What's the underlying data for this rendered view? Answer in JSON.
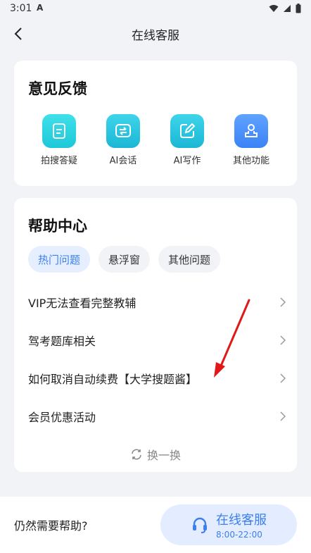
{
  "status_bar": {
    "time": "3:01",
    "notif_icon": "A",
    "icons": [
      "wifi-icon",
      "signal-icon",
      "battery-icon"
    ]
  },
  "nav": {
    "title": "在线客服",
    "back_icon": "chevron-left-icon"
  },
  "feedback": {
    "title": "意见反馈",
    "items": [
      {
        "label": "拍搜答疑",
        "icon": "document-icon",
        "color": "#22cfdf"
      },
      {
        "label": "AI会话",
        "icon": "chat-swap-icon",
        "color": "#22c0db"
      },
      {
        "label": "AI写作",
        "icon": "edit-pencil-icon",
        "color": "#22c0db"
      },
      {
        "label": "其他功能",
        "icon": "person-stamp-icon",
        "color": "#4b90fa"
      }
    ]
  },
  "help_center": {
    "title": "帮助中心",
    "tabs": [
      {
        "label": "热门问题",
        "active": true
      },
      {
        "label": "悬浮窗",
        "active": false
      },
      {
        "label": "其他问题",
        "active": false
      }
    ],
    "questions": [
      "VIP无法查看完整教辅",
      "驾考题库相关",
      "如何取消自动续费【大学搜题酱】",
      "会员优惠活动"
    ],
    "refresh_label": "换一换"
  },
  "bottom": {
    "help_text": "仍然需要帮助?",
    "cs_button": {
      "label": "在线客服",
      "hours": "8:00-22:00"
    }
  },
  "colors": {
    "accent": "#3b7ff0",
    "annotation_arrow": "#e01818"
  }
}
